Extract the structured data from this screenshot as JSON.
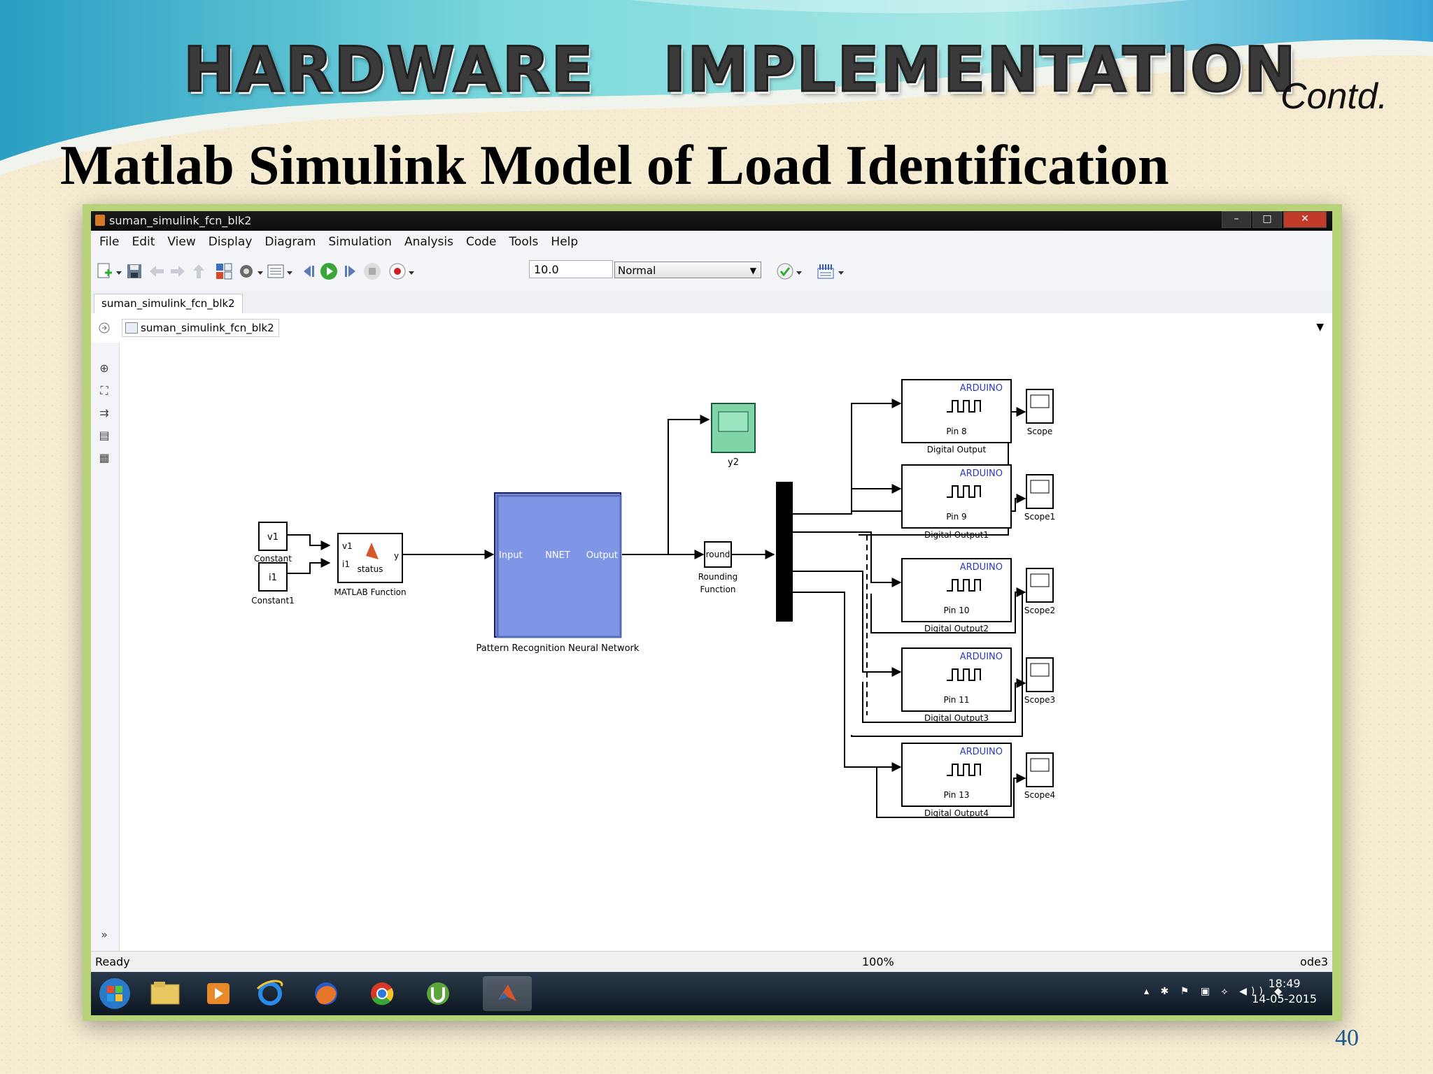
{
  "slide": {
    "heading": "HARDWARE   IMPLEMENTATION",
    "contd": "Contd.",
    "subtitle": "Matlab Simulink Model of Load Identification",
    "page_number": "40"
  },
  "window": {
    "title": "suman_simulink_fcn_blk2",
    "buttons": [
      "–",
      "□",
      "✕"
    ]
  },
  "menu": [
    "File",
    "Edit",
    "View",
    "Display",
    "Diagram",
    "Simulation",
    "Analysis",
    "Code",
    "Tools",
    "Help"
  ],
  "toolbar": {
    "stop_time": "10.0",
    "sim_mode": "Normal"
  },
  "tab": {
    "label": "suman_simulink_fcn_blk2"
  },
  "breadcrumb": {
    "label": "suman_simulink_fcn_blk2"
  },
  "blocks": {
    "constant": {
      "value": "v1",
      "name": "Constant"
    },
    "constant1": {
      "value": "i1",
      "name": "Constant1"
    },
    "matlab_function": {
      "in1": "v1",
      "in2": "i1",
      "status": "status",
      "out": "y",
      "name": "MATLAB Function"
    },
    "nnet": {
      "input": "Input",
      "core": "NNET",
      "output": "Output",
      "name": "Pattern Recognition Neural Network"
    },
    "y2": {
      "name": "y2"
    },
    "rounding": {
      "op": "round",
      "name_line1": "Rounding",
      "name_line2": "Function"
    },
    "digital_outputs": [
      {
        "vendor": "ARDUINO",
        "pin": "Pin 8",
        "name": "Digital Output"
      },
      {
        "vendor": "ARDUINO",
        "pin": "Pin 9",
        "name": "Digital Output1"
      },
      {
        "vendor": "ARDUINO",
        "pin": "Pin 10",
        "name": "Digital Output2"
      },
      {
        "vendor": "ARDUINO",
        "pin": "Pin 11",
        "name": "Digital Output3"
      },
      {
        "vendor": "ARDUINO",
        "pin": "Pin 13",
        "name": "Digital Output4"
      }
    ],
    "scopes": [
      "Scope",
      "Scope1",
      "Scope2",
      "Scope3",
      "Scope4"
    ]
  },
  "status": {
    "ready": "Ready",
    "zoom": "100%",
    "solver": "ode3"
  },
  "clock": {
    "time": "18:49",
    "date": "14-05-2015"
  },
  "colors": {
    "nnet_fill": "#7f96e6",
    "scope_y2_fill": "#7fd4a8",
    "arduino_blue": "#2a3ab8",
    "frame_green": "#b8d27a"
  }
}
